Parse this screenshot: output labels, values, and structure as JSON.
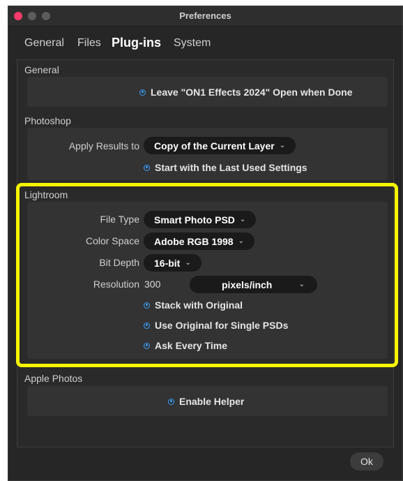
{
  "window": {
    "title": "Preferences",
    "traffic_light_colors": [
      "#ff3b6b",
      "#5c5c5c",
      "#5c5c5c"
    ]
  },
  "tabs": [
    {
      "label": "General",
      "active": false
    },
    {
      "label": "Files",
      "active": false
    },
    {
      "label": "Plug-ins",
      "active": true
    },
    {
      "label": "System",
      "active": false
    }
  ],
  "sections": {
    "general": {
      "label": "General",
      "leave_open": {
        "label": "Leave \"ON1 Effects 2024\" Open when Done",
        "checked": true
      }
    },
    "photoshop": {
      "label": "Photoshop",
      "apply_results": {
        "label": "Apply Results to",
        "value": "Copy of the Current Layer"
      },
      "start_last": {
        "label": "Start with the Last Used Settings",
        "checked": true
      }
    },
    "lightroom": {
      "label": "Lightroom",
      "file_type": {
        "label": "File Type",
        "value": "Smart Photo PSD"
      },
      "color_space": {
        "label": "Color Space",
        "value": "Adobe RGB 1998"
      },
      "bit_depth": {
        "label": "Bit Depth",
        "value": "16-bit"
      },
      "resolution": {
        "label": "Resolution",
        "value": "300",
        "unit": "pixels/inch"
      },
      "stack_original": {
        "label": "Stack with Original",
        "checked": true
      },
      "use_original": {
        "label": "Use Original for Single PSDs",
        "checked": true
      },
      "ask_every_time": {
        "label": "Ask Every Time",
        "checked": true
      }
    },
    "apple_photos": {
      "label": "Apple Photos",
      "enable_helper": {
        "label": "Enable Helper",
        "checked": true
      }
    }
  },
  "footer": {
    "ok_label": "Ok"
  },
  "colors": {
    "accent": "#3aa0ff",
    "highlight": "#f5f500",
    "window_bg": "#262626"
  }
}
